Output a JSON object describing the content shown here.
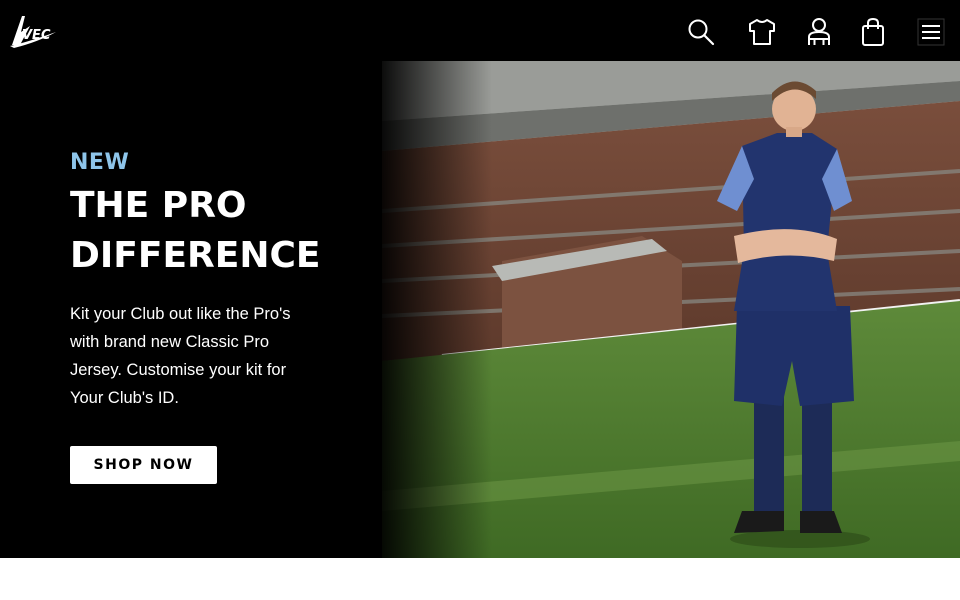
{
  "brand": {
    "logo_text": "AVEC",
    "accent_color": "#8ec5ea",
    "background_color": "#000000"
  },
  "header": {
    "icons": [
      {
        "name": "search-icon"
      },
      {
        "name": "shirt-icon"
      },
      {
        "name": "account-icon"
      },
      {
        "name": "shopping-bag-icon"
      },
      {
        "name": "hamburger-menu-icon"
      }
    ]
  },
  "hero": {
    "eyebrow": "NEW",
    "headline_line1": "THE PRO",
    "headline_line2": "DIFFERENCE",
    "body": "Kit your Club out like the Pro's with brand new Classic Pro Jersey. Customise your kit for Your Club's ID.",
    "cta_label": "SHOP NOW",
    "image_subject": "football-player-in-navy-kit-on-pitch"
  }
}
